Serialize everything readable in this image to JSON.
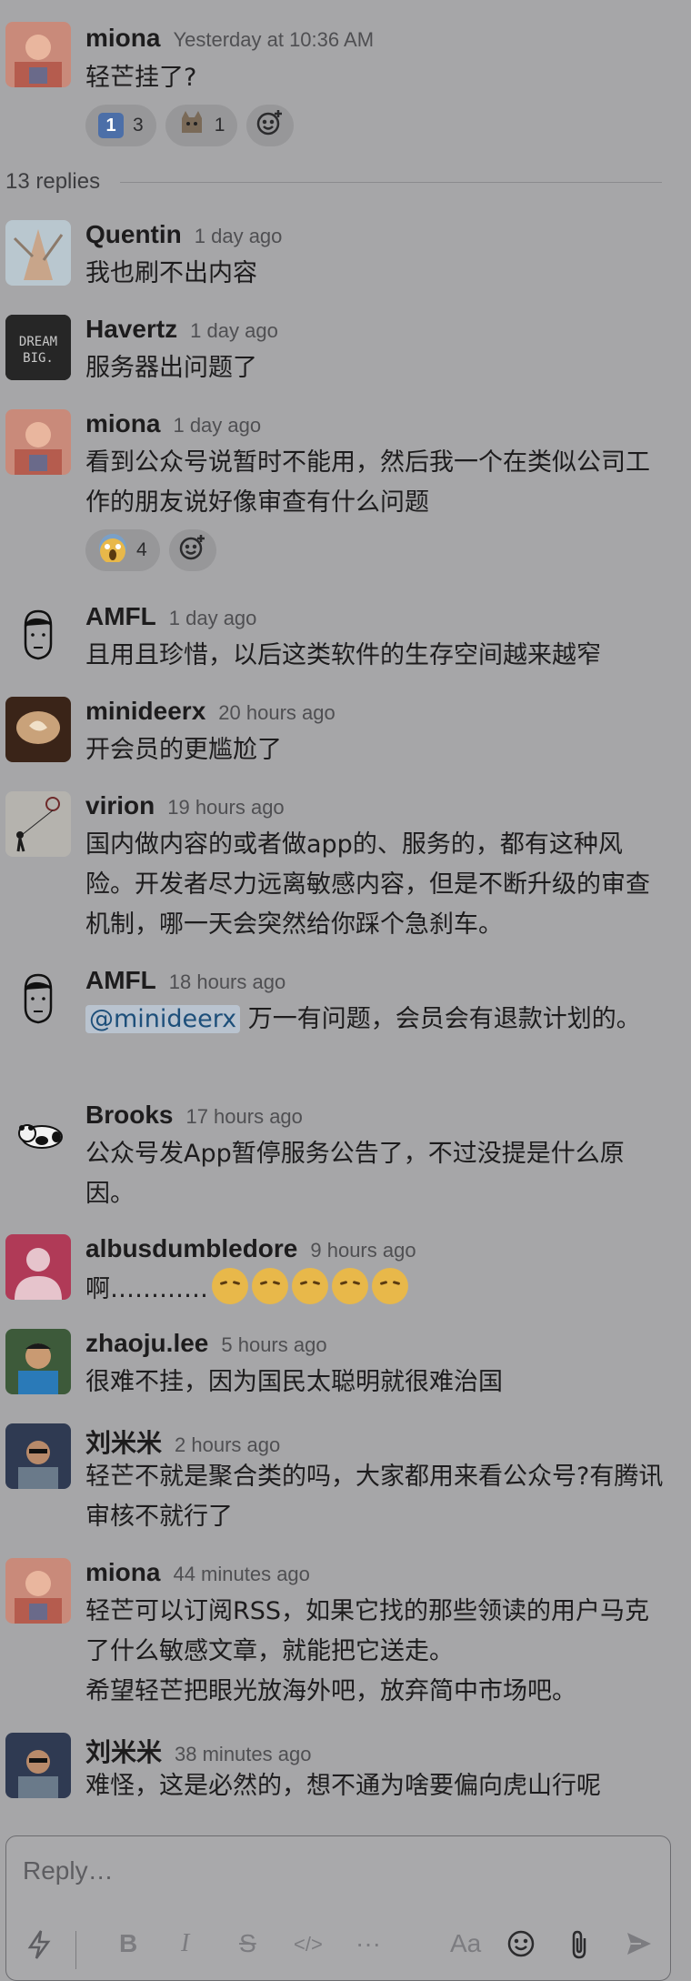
{
  "parent": {
    "author": "miona",
    "time": "Yesterday at 10:36 AM",
    "text": "轻芒挂了?",
    "reactions": [
      {
        "emoji": "keycap-1",
        "count": "3"
      },
      {
        "emoji": "cat-face",
        "count": "1"
      }
    ]
  },
  "thread": {
    "replies_label": "13 replies"
  },
  "messages": [
    {
      "author": "Quentin",
      "time": "1 day ago",
      "text": "我也刷不出内容"
    },
    {
      "author": "Havertz",
      "time": "1 day ago",
      "text": "服务器出问题了",
      "avatar_text": "DREAM BIG."
    },
    {
      "author": "miona",
      "time": "1 day ago",
      "text": "看到公众号说暂时不能用，然后我一个在类似公司工作的朋友说好像审查有什么问题",
      "reaction_count": "4"
    },
    {
      "author": "AMFL",
      "time": "1 day ago",
      "text": "且用且珍惜，以后这类软件的生存空间越来越窄"
    },
    {
      "author": "minideerx",
      "time": "20 hours ago",
      "text": "开会员的更尴尬了"
    },
    {
      "author": "virion",
      "time": "19 hours ago",
      "text": "国内做内容的或者做app的、服务的，都有这种风险。开发者尽力远离敏感内容，但是不断升级的审查机制，哪一天会突然给你踩个急刹车。"
    },
    {
      "author": "AMFL",
      "time": "18 hours ago",
      "mention": "@minideerx",
      "text": " 万一有问题，会员会有退款计划的。"
    },
    {
      "author": "Brooks",
      "time": "17 hours ago",
      "text": "公众号发App暂停服务公告了，不过没提是什么原因。"
    },
    {
      "author": "albusdumbledore",
      "time": "9 hours ago",
      "text": "啊…………"
    },
    {
      "author": "zhaoju.lee",
      "time": "5 hours ago",
      "text": "很难不挂，因为国民太聪明就很难治国"
    },
    {
      "author": "刘米米",
      "time": "2 hours ago",
      "text": "轻芒不就是聚合类的吗，大家都用来看公众号?有腾讯审核不就行了"
    },
    {
      "author": "miona",
      "time": "44 minutes ago",
      "text": "轻芒可以订阅RSS，如果它找的那些领读的用户马克了什么敏感文章，就能把它送走。",
      "text2": "希望轻芒把眼光放海外吧，放弃简中市场吧。"
    },
    {
      "author": "刘米米",
      "time": "38 minutes ago",
      "text": "难怪，这是必然的，想不通为啥要偏向虎山行呢"
    }
  ],
  "composer": {
    "placeholder": "Reply…",
    "format_bold": "B",
    "format_italic": "I",
    "format_strike": "S",
    "format_code": "</>",
    "more": "···",
    "text_format": "Aa"
  }
}
